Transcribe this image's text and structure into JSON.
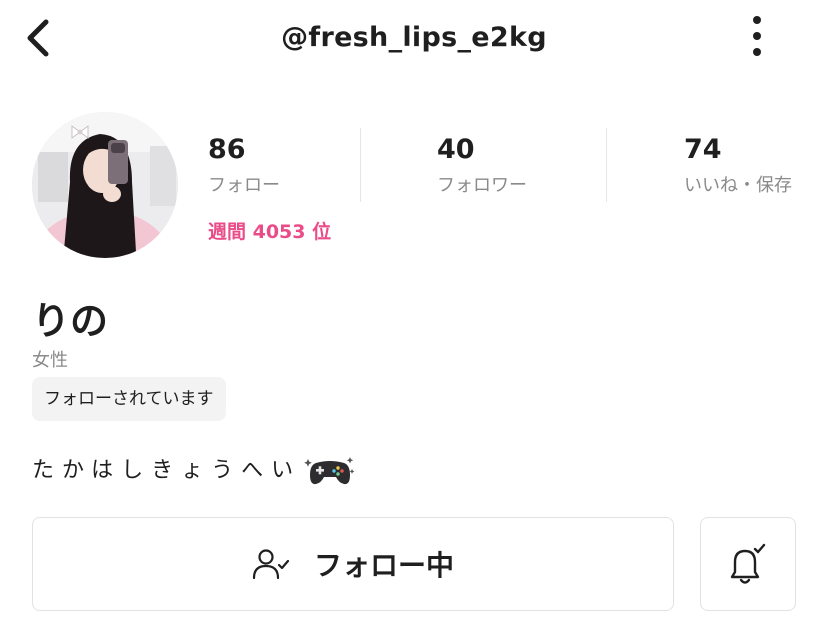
{
  "header": {
    "username": "@fresh_lips_e2kg",
    "back_icon": "chevron-left-icon",
    "more_icon": "vertical-ellipsis-icon"
  },
  "profile": {
    "avatar": "profile-photo",
    "display_name": "りの",
    "gender": "女性",
    "follows_you_label": "フォローされています",
    "rank_label": "週間 4053 位",
    "bio_text": "たかはしきょうへい",
    "bio_emoji": "sparkle-gamepad-icon"
  },
  "stats": [
    {
      "value": "86",
      "label": "フォロー"
    },
    {
      "value": "40",
      "label": "フォロワー"
    },
    {
      "value": "74",
      "label": "いいね・保存"
    }
  ],
  "actions": {
    "follow_label": "フォロー中",
    "follow_icon": "user-check-icon",
    "bell_icon": "bell-check-icon"
  },
  "colors": {
    "accent_pink": "#ea4c89",
    "muted_text": "#8a8a8a",
    "border": "#e2e2e2"
  }
}
